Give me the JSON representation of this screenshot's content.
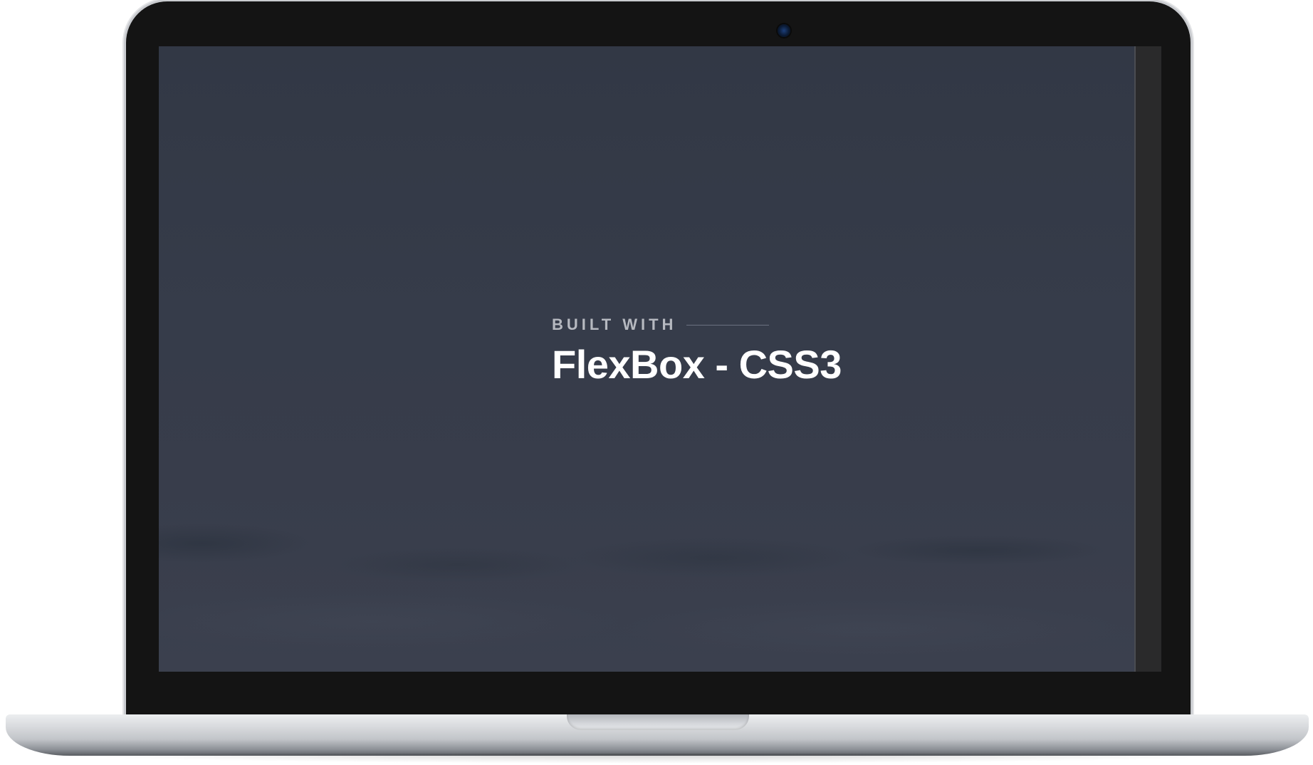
{
  "hero": {
    "eyebrow": "BUILT WITH",
    "headline": "FlexBox - CSS3"
  },
  "colors": {
    "screen_background": "#363c4a",
    "headline_text": "#ffffff",
    "eyebrow_text": "#b6b9c0",
    "bezel": "#141414"
  }
}
